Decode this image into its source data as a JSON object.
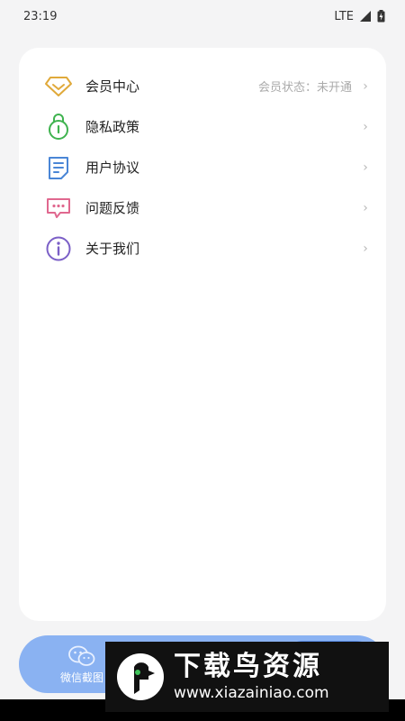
{
  "status_bar": {
    "time": "23:19",
    "network": "LTE"
  },
  "menu": {
    "items": [
      {
        "label": "会员中心",
        "value": "会员状态：未开通",
        "icon": "diamond-icon",
        "color": "#e0a93a"
      },
      {
        "label": "隐私政策",
        "value": "",
        "icon": "lock-icon",
        "color": "#3fb34f"
      },
      {
        "label": "用户协议",
        "value": "",
        "icon": "document-icon",
        "color": "#4a86d6"
      },
      {
        "label": "问题反馈",
        "value": "",
        "icon": "chat-icon",
        "color": "#e0688f"
      },
      {
        "label": "关于我们",
        "value": "",
        "icon": "info-icon",
        "color": "#7b5fc7"
      }
    ],
    "chevron": "›"
  },
  "bottom_nav": {
    "tab1_label": "微信截图"
  },
  "watermark": {
    "title": "下载鸟资源",
    "url": "www.xiazainiao.com"
  }
}
